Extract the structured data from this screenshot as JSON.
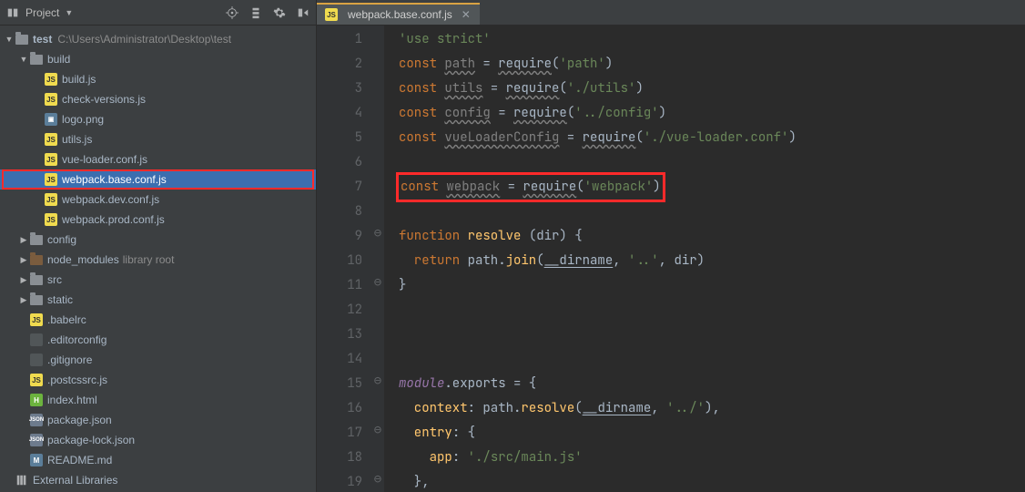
{
  "sidebar": {
    "title": "Project",
    "root": {
      "name": "test",
      "path": "C:\\Users\\Administrator\\Desktop\\test"
    },
    "build": {
      "name": "build",
      "files": [
        {
          "name": "build.js",
          "icon": "js"
        },
        {
          "name": "check-versions.js",
          "icon": "js"
        },
        {
          "name": "logo.png",
          "icon": "png"
        },
        {
          "name": "utils.js",
          "icon": "js"
        },
        {
          "name": "vue-loader.conf.js",
          "icon": "js"
        },
        {
          "name": "webpack.base.conf.js",
          "icon": "js",
          "selected": true
        },
        {
          "name": "webpack.dev.conf.js",
          "icon": "js"
        },
        {
          "name": "webpack.prod.conf.js",
          "icon": "js"
        }
      ]
    },
    "folders2": [
      {
        "name": "config",
        "open": false
      },
      {
        "name": "node_modules",
        "open": false,
        "note": "library root",
        "class": "excl"
      },
      {
        "name": "src",
        "open": false
      },
      {
        "name": "static",
        "open": false
      }
    ],
    "root_files": [
      {
        "name": ".babelrc",
        "icon": "js"
      },
      {
        "name": ".editorconfig",
        "icon": "txt"
      },
      {
        "name": ".gitignore",
        "icon": "txt"
      },
      {
        "name": ".postcssrc.js",
        "icon": "js"
      },
      {
        "name": "index.html",
        "icon": "html"
      },
      {
        "name": "package.json",
        "icon": "json"
      },
      {
        "name": "package-lock.json",
        "icon": "json"
      },
      {
        "name": "README.md",
        "icon": "md"
      }
    ],
    "ext_lib": "External Libraries"
  },
  "editor": {
    "tab_label": "webpack.base.conf.js",
    "lines": [
      "1",
      "2",
      "3",
      "4",
      "5",
      "6",
      "7",
      "8",
      "9",
      "10",
      "11",
      "12",
      "13",
      "14",
      "15",
      "16",
      "17",
      "18",
      "19"
    ],
    "fold": [
      "",
      "",
      "",
      "",
      "",
      "",
      "",
      "",
      "⊖",
      "",
      "⊖",
      "",
      "",
      "",
      "⊖",
      "",
      "⊖",
      "",
      "⊖"
    ],
    "code": {
      "l1": "'use strict'",
      "l2": {
        "kw": "const ",
        "v": "path",
        "eq": " = ",
        "fn": "require",
        "args": "('path')"
      },
      "l3": {
        "kw": "const ",
        "v": "utils",
        "eq": " = ",
        "fn": "require",
        "args": "('./utils')"
      },
      "l4": {
        "kw": "const ",
        "v": "config",
        "eq": " = ",
        "fn": "require",
        "args": "('../config')"
      },
      "l5": {
        "kw": "const ",
        "v": "vueLoaderConfig",
        "eq": " = ",
        "fn": "require",
        "args": "('./vue-loader.conf')"
      },
      "l7": {
        "kw": "const ",
        "v": "webpack",
        "eq": " = ",
        "fn": "require",
        "args": "('webpack')"
      },
      "l9a": "function ",
      "l9b": "resolve ",
      "l9c": "(dir) {",
      "l10a": "  return ",
      "l10b": "path.",
      "l10c": "join",
      "l10d": "(",
      "l10e": "__dirname",
      "l10f": ", ",
      "l10g": "'..'",
      "l10h": ", dir)",
      "l11": "}",
      "l15a": "module",
      "l15b": ".exports = {",
      "l16a": "  context",
      "l16b": ": path.",
      "l16c": "resolve",
      "l16d": "(",
      "l16e": "__dirname",
      "l16f": ", ",
      "l16g": "'../'",
      "l16h": "),",
      "l17a": "  entry",
      "l17b": ": {",
      "l18a": "    app",
      "l18b": ": ",
      "l18c": "'./src/main.js'",
      "l19": "  },"
    }
  }
}
